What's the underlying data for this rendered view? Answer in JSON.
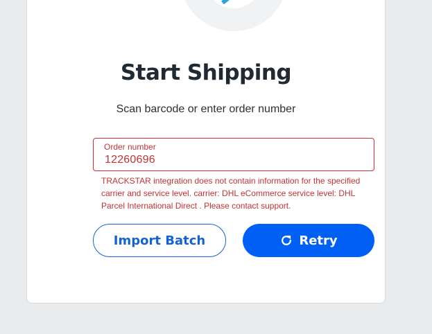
{
  "header": {
    "icon": "shipping-box-icon",
    "title": "Start Shipping",
    "subtitle": "Scan barcode or enter order number"
  },
  "order_field": {
    "label": "Order number",
    "value": "12260696",
    "error": "TRACKSTAR integration does not contain information for the specified carrier and service level. carrier: DHL eCommerce service level: DHL Parcel International Direct . Please contact support."
  },
  "actions": {
    "import_batch_label": "Import Batch",
    "retry_label": "Retry",
    "retry_icon": "refresh-icon"
  },
  "colors": {
    "primary": "#005ff5",
    "error": "#c73030",
    "title": "#212a33",
    "background": "#e9ebed"
  }
}
